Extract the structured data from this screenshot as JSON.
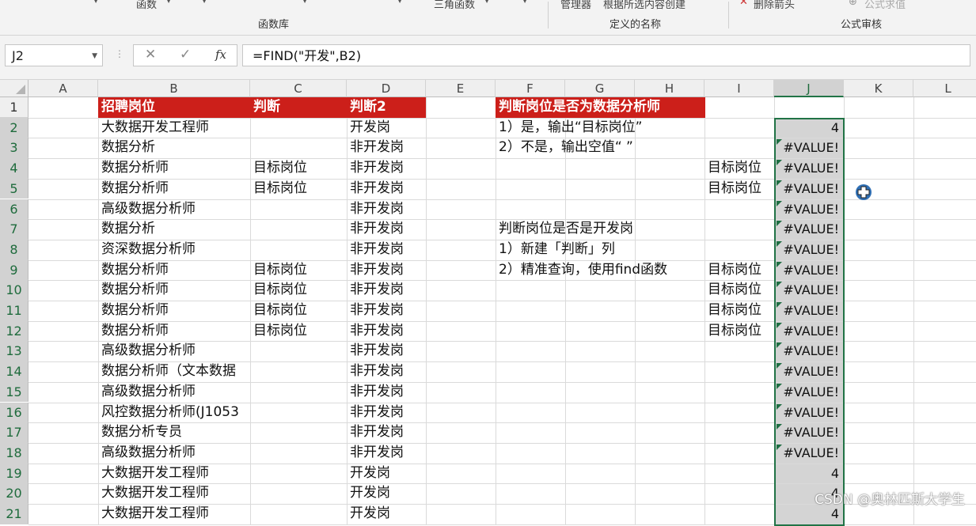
{
  "ribbon": {
    "top_items": [
      "函数",
      "三角函数",
      "管理器",
      "根据所选内容创建",
      "删除箭头",
      "公式求值"
    ],
    "groups": [
      "函数库",
      "定义的名称",
      "公式审核"
    ]
  },
  "formula_bar": {
    "name_box": "J2",
    "cancel_icon": "✕",
    "enter_icon": "✓",
    "fx_label": "fx",
    "formula": "=FIND(\"开发\",B2)"
  },
  "columns": [
    "A",
    "B",
    "C",
    "D",
    "E",
    "F",
    "G",
    "H",
    "I",
    "J",
    "K",
    "L"
  ],
  "selected_column": "J",
  "rows": [
    "1",
    "2",
    "3",
    "4",
    "5",
    "6",
    "7",
    "8",
    "9",
    "10",
    "11",
    "12",
    "13",
    "14",
    "15",
    "16",
    "17",
    "18",
    "19",
    "20",
    "21"
  ],
  "headers": {
    "b": "招聘岗位",
    "c": "判断",
    "d": "判断2",
    "f": "判断岗位是否为数据分析师"
  },
  "col_b": [
    "大数据开发工程师",
    "数据分析",
    "数据分析师",
    "数据分析师",
    "高级数据分析师",
    "数据分析",
    "资深数据分析师",
    "数据分析师",
    "数据分析师",
    "数据分析师",
    "数据分析师",
    "高级数据分析师",
    "数据分析师（文本数据",
    "高级数据分析师",
    "风控数据分析师(J1053",
    "数据分析专员",
    "高级数据分析师",
    "大数据开发工程师",
    "大数据开发工程师",
    "大数据开发工程师"
  ],
  "col_c": [
    "",
    "",
    "目标岗位",
    "目标岗位",
    "",
    "",
    "",
    "目标岗位",
    "目标岗位",
    "目标岗位",
    "目标岗位",
    "",
    "",
    "",
    "",
    "",
    "",
    "",
    "",
    ""
  ],
  "col_d": [
    "开发岗",
    "非开发岗",
    "非开发岗",
    "非开发岗",
    "非开发岗",
    "非开发岗",
    "非开发岗",
    "非开发岗",
    "非开发岗",
    "非开发岗",
    "非开发岗",
    "非开发岗",
    "非开发岗",
    "非开发岗",
    "非开发岗",
    "非开发岗",
    "非开发岗",
    "开发岗",
    "开发岗",
    "开发岗"
  ],
  "col_f": [
    "1）是，输出“目标岗位”",
    "2）不是，输出空值“ ”",
    "",
    "",
    "",
    "判断岗位是否是开发岗",
    "1）新建「判断」列",
    "2）精准查询，使用find函数",
    "",
    "",
    "",
    "",
    "",
    "",
    "",
    "",
    "",
    "",
    "",
    ""
  ],
  "col_i": [
    "",
    "",
    "目标岗位",
    "目标岗位",
    "",
    "",
    "",
    "目标岗位",
    "目标岗位",
    "目标岗位",
    "目标岗位",
    "",
    "",
    "",
    "",
    "",
    "",
    "",
    "",
    ""
  ],
  "col_j": [
    "4",
    "#VALUE!",
    "#VALUE!",
    "#VALUE!",
    "#VALUE!",
    "#VALUE!",
    "#VALUE!",
    "#VALUE!",
    "#VALUE!",
    "#VALUE!",
    "#VALUE!",
    "#VALUE!",
    "#VALUE!",
    "#VALUE!",
    "#VALUE!",
    "#VALUE!",
    "#VALUE!",
    "4",
    "4",
    "4"
  ],
  "watermark": "CSDN @奥林匹斯大学生"
}
